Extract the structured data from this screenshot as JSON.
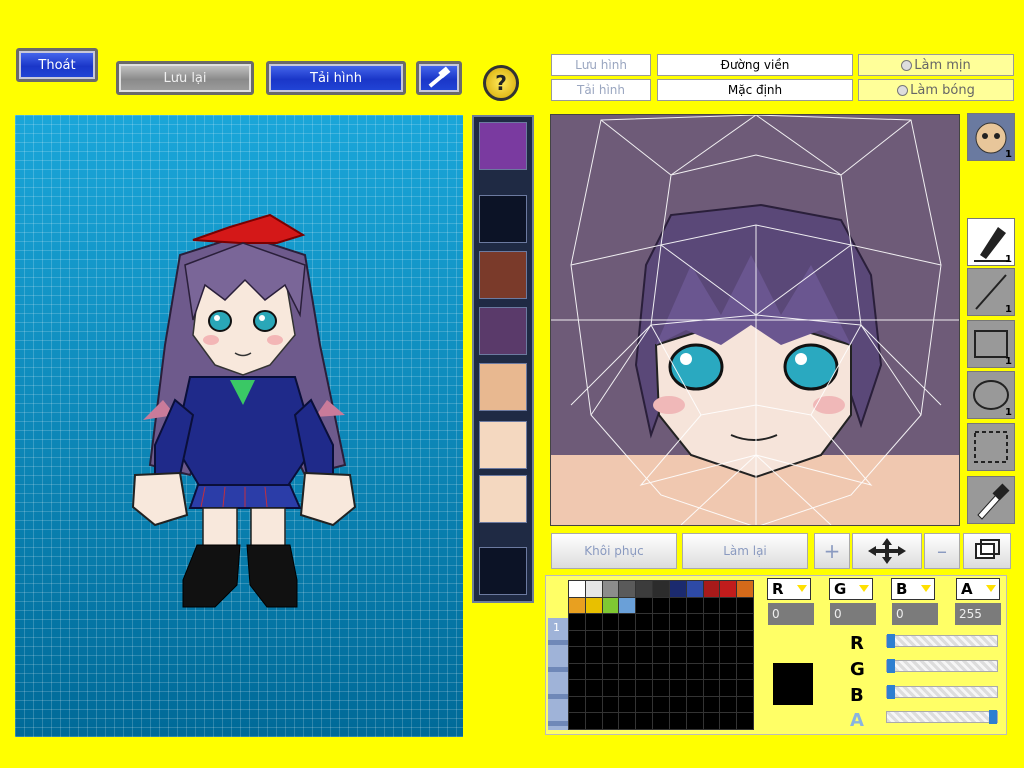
{
  "top_buttons": {
    "exit": "Thoát",
    "save": "Lưu lại",
    "reload": "Tải hình"
  },
  "editor_toolbar": {
    "save_image": "Lưu hình",
    "load_image": "Tải hình",
    "outline": "Đường viền",
    "default": "Mặc định",
    "smooth": "Làm mịn",
    "shade": "Làm bóng"
  },
  "tool_counts": {
    "face_preview": "1",
    "pen": "1",
    "line": "1",
    "rect": "1",
    "ellipse": "1"
  },
  "bottom_buttons": {
    "restore": "Khôi phục",
    "redo": "Làm lại"
  },
  "palette": {
    "tab_label": "1",
    "swatches": [
      "#ffffff",
      "#e6e6e6",
      "#8c8c8c",
      "#5a5a5a",
      "#3c3c3c",
      "#2c2c2c",
      "#1b2a6e",
      "#2e4aa6",
      "#a81a1a",
      "#c11c1c",
      "#d46a1a",
      "#e8a020",
      "#e8c000",
      "#7fc832",
      "#6aa0d8",
      "#000000",
      "#000000",
      "#000000",
      "#000000",
      "#000000",
      "#000000",
      "#000000"
    ],
    "selected_color": "#000000"
  },
  "color_channels": {
    "labels": [
      "R",
      "G",
      "B",
      "A"
    ],
    "values": [
      "0",
      "0",
      "0",
      "255"
    ],
    "slider_labels": [
      "R",
      "G",
      "B",
      "A"
    ],
    "levels": [
      0,
      0,
      0,
      255
    ]
  },
  "colors": {
    "background": "#ffff00",
    "stage": "#0a8fc7",
    "editor_bg": "#6e5b78"
  }
}
